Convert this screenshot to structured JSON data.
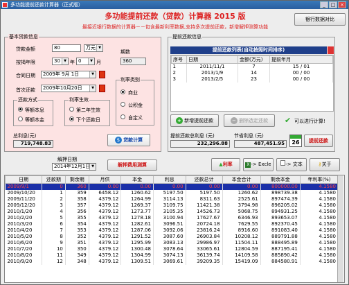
{
  "window": {
    "title": "多功能提前还款计算器（正式版）",
    "min": "_",
    "max": "□",
    "close": "×"
  },
  "header": {
    "title": "多功能提前还款（贷款）计算器 2015 版",
    "subtitle": "最接近银行数据的计算器－－包含最新利率数据,支持多次提前还款，新增解押测算功能",
    "compare_button": "银行数据对比"
  },
  "basic": {
    "group_label": "基本贷款信息",
    "amount_label": "贷款金额",
    "amount_value": "80",
    "unit": "万元",
    "period_label": "期数",
    "years_label": "按揭年限",
    "years_value": "30",
    "year_unit": "年",
    "months_value": "0",
    "month_unit": "月",
    "period_value": "360",
    "contract_date_label": "合同日期",
    "contract_date": "2009年 9月 1日",
    "first_pay_label": "首次还款",
    "first_pay_date": "2009年10月20日"
  },
  "repay_method": {
    "label": "还款方式",
    "options": [
      "等额本息",
      "等额本金"
    ]
  },
  "rate_effective": {
    "label": "利率生效",
    "options": [
      "第二年生效",
      "下个还款日"
    ]
  },
  "rate_type": {
    "label": "利率类别",
    "options": [
      "商业",
      "公积金",
      "自定义"
    ]
  },
  "total_interest": {
    "label": "总利息(元)",
    "value": "719,748.83"
  },
  "calc_button": "贷款计算",
  "prepay": {
    "group_label": "提前还款信息",
    "list_title": "提前还款列表(自动按照时间排序)",
    "columns": [
      "序号",
      "日期",
      "金额(万元)",
      "提前年月"
    ],
    "rows": [
      [
        "1",
        "2011/11/1",
        "7",
        "15 / 01"
      ],
      [
        "2",
        "2013/1/9",
        "14",
        "00 / 00"
      ],
      [
        "3",
        "2013/2/5",
        "23",
        "00 / 00"
      ]
    ],
    "add_button": "新增提前还款",
    "delete_button": "删除选定还款",
    "ready_text": "可以进行计算!",
    "prepay_total_label": "提前还款总利息 (元)",
    "prepay_total_value": "232,296.88",
    "saved_label": "节省利息 (元)",
    "saved_value": "487,451.95",
    "calendar_day": "26",
    "calc_button": "提前还款"
  },
  "release": {
    "label": "解押日期",
    "date": "2014年12月1日",
    "button": "解押费用测算"
  },
  "toolbar": {
    "interest": "利率",
    "excel": "-> Excle",
    "text": "-> 文本",
    "about": "关于"
  },
  "schedule": {
    "columns": [
      "日期",
      "还款期",
      "剩余期",
      "月供",
      "本金",
      "利息",
      "还款总计",
      "本金合计",
      "剩余本金",
      "年利率(%)"
    ],
    "rows": [
      [
        "2009/9/1",
        "0",
        "360",
        "0.00",
        "0.00",
        "0.00",
        "0.00",
        "0.00",
        "800000.00",
        "4.1580"
      ],
      [
        "2009/10/20",
        "1",
        "359",
        "6458.12",
        "1260.62",
        "5197.50",
        "5197.50",
        "1260.62",
        "898739.38",
        "4.1580"
      ],
      [
        "2009/11/20",
        "2",
        "358",
        "4379.12",
        "1264.99",
        "3114.13",
        "8311.63",
        "2525.61",
        "897474.39",
        "4.1580"
      ],
      [
        "2009/12/20",
        "3",
        "357",
        "4379.12",
        "1269.37",
        "3109.75",
        "11421.38",
        "3794.98",
        "896205.02",
        "4.1580"
      ],
      [
        "2010/1/20",
        "4",
        "356",
        "4379.12",
        "1273.77",
        "3105.35",
        "14526.73",
        "5068.75",
        "894931.25",
        "4.1580"
      ],
      [
        "2010/2/20",
        "5",
        "355",
        "4379.12",
        "1278.18",
        "3100.94",
        "17627.67",
        "6346.93",
        "893653.07",
        "4.1580"
      ],
      [
        "2010/3/20",
        "6",
        "354",
        "4379.12",
        "1282.61",
        "3096.51",
        "20724.18",
        "7629.55",
        "892370.45",
        "4.1580"
      ],
      [
        "2010/4/20",
        "7",
        "353",
        "4379.12",
        "1287.06",
        "3092.06",
        "23816.24",
        "8916.60",
        "891083.40",
        "4.1580"
      ],
      [
        "2010/5/20",
        "8",
        "352",
        "4379.12",
        "1291.52",
        "3087.60",
        "26903.84",
        "10208.12",
        "889791.88",
        "4.1580"
      ],
      [
        "2010/6/20",
        "9",
        "351",
        "4379.12",
        "1295.99",
        "3083.13",
        "29986.97",
        "11504.11",
        "888495.89",
        "4.1580"
      ],
      [
        "2010/7/20",
        "10",
        "350",
        "4379.12",
        "1300.48",
        "3078.64",
        "33065.61",
        "12804.59",
        "887195.41",
        "4.1580"
      ],
      [
        "2010/8/20",
        "11",
        "349",
        "4379.12",
        "1304.99",
        "3074.13",
        "36139.74",
        "14109.58",
        "885890.42",
        "4.1580"
      ],
      [
        "2010/9/20",
        "12",
        "348",
        "4379.12",
        "1309.51",
        "3069.61",
        "39209.35",
        "15419.09",
        "884580.91",
        "4.1580"
      ]
    ]
  },
  "colors": {
    "accent_red": "#dd2222",
    "pink_panel": "#fde3e3",
    "table_header_blue": "#1f3f8a",
    "selected_row": "#1a2fa8"
  }
}
